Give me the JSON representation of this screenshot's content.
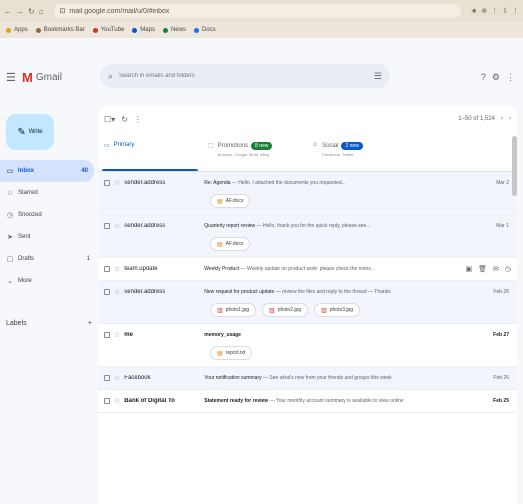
{
  "browser": {
    "nav": [
      "←",
      "→",
      "↻",
      "⌂"
    ],
    "url": "mail.google.com/mail/u/0/#inbox",
    "extensions": [
      "★",
      "⊕",
      "⋮",
      "⇩",
      "⋮"
    ],
    "bookmarks": [
      {
        "label": "Apps",
        "color": "#e0a800"
      },
      {
        "label": "Bookmarks Bar",
        "color": "#8a6d3b"
      },
      {
        "label": "YouTube",
        "color": "#d93025"
      },
      {
        "label": "Maps",
        "color": "#0b57d0"
      },
      {
        "label": "News",
        "color": "#188038"
      },
      {
        "label": "Docs",
        "color": "#1a73e8"
      }
    ]
  },
  "header": {
    "menu_glyph": "☰",
    "logo_m": "M",
    "logo_text": "Gmail",
    "search_placeholder": "Search in emails and folders",
    "search_glyph": "⌕",
    "filter_glyph": "☰",
    "right_icons": [
      "?",
      "⚙",
      "⋮"
    ]
  },
  "sidebar": {
    "compose_label": "Write",
    "compose_glyph": "✎",
    "items": [
      {
        "icon": "▭",
        "label": "Inbox",
        "count": "40",
        "active": true
      },
      {
        "icon": "☆",
        "label": "Starred",
        "count": "",
        "active": false
      },
      {
        "icon": "◷",
        "label": "Snoozed",
        "count": "",
        "active": false
      },
      {
        "icon": "➤",
        "label": "Sent",
        "count": "",
        "active": false
      },
      {
        "icon": "▢",
        "label": "Drafts",
        "count": "1",
        "active": false
      },
      {
        "icon": "⌄",
        "label": "More",
        "count": "",
        "active": false
      }
    ],
    "labels_title": "Labels",
    "labels_add": "+"
  },
  "toolbar": {
    "select_glyph": "☐▾",
    "refresh_glyph": "↻",
    "more_glyph": "⋮",
    "pagination": "1–50 of 1,524",
    "prev": "‹",
    "next": "›"
  },
  "tabs": [
    {
      "icon": "▭",
      "title": "Primary",
      "badge": "",
      "badge_color": "",
      "sub": "",
      "active": true
    },
    {
      "icon": "⬚",
      "title": "Promotions",
      "badge": "8 new",
      "badge_color": "#188038",
      "sub": "Amazon, Google Store, eBay",
      "active": false
    },
    {
      "icon": "☺",
      "title": "Social",
      "badge": "2 new",
      "badge_color": "#0b57d0",
      "sub": "Facebook, Twitter",
      "active": false
    }
  ],
  "mails": [
    {
      "sender": "sender.address",
      "subject": "Re: Agenda",
      "snippet": "— Hello, I attached the documents you requested...",
      "date": "Mar 2",
      "read": true,
      "unread": false,
      "chips": [
        {
          "icon": "▤",
          "label": "AF.docx"
        }
      ]
    },
    {
      "sender": "sender.address",
      "subject": "Quarterly report review",
      "snippet": "— Hello, thank you for the quick reply, please see...",
      "date": "Mar 1",
      "read": true,
      "unread": false,
      "chips": [
        {
          "icon": "▤",
          "label": "AF.docx"
        }
      ]
    },
    {
      "sender": "team.update",
      "subject": "Weekly Product",
      "snippet": "— Weekly update on product work: please check the notes...",
      "date": "",
      "read": false,
      "unread": false,
      "hover": true,
      "chips": []
    },
    {
      "sender": "sender.address",
      "subject": "New request for product update",
      "snippet": "— review the files and reply to the thread — Thanks",
      "date": "Feb 28",
      "read": true,
      "unread": false,
      "chips": [
        {
          "icon": "▥",
          "label": "photo1.jpg"
        },
        {
          "icon": "▥",
          "label": "photo2.jpg"
        },
        {
          "icon": "▥",
          "label": "photo3.jpg"
        }
      ]
    },
    {
      "sender": "me",
      "subject": "memory_usage",
      "snippet": "",
      "date": "Feb 27",
      "read": false,
      "unread": true,
      "chips": [
        {
          "icon": "▤",
          "label": "report.txt"
        }
      ]
    },
    {
      "sender": "Facebook",
      "subject": "Your notification summary",
      "snippet": "— See what's new from your friends and groups this week",
      "date": "Feb 26",
      "read": true,
      "unread": false,
      "chips": []
    },
    {
      "sender": "Bank of Digital To",
      "subject": "Statement ready for review",
      "snippet": "— Your monthly account summary is available to view online",
      "date": "Feb 25",
      "read": false,
      "unread": true,
      "chips": []
    }
  ]
}
